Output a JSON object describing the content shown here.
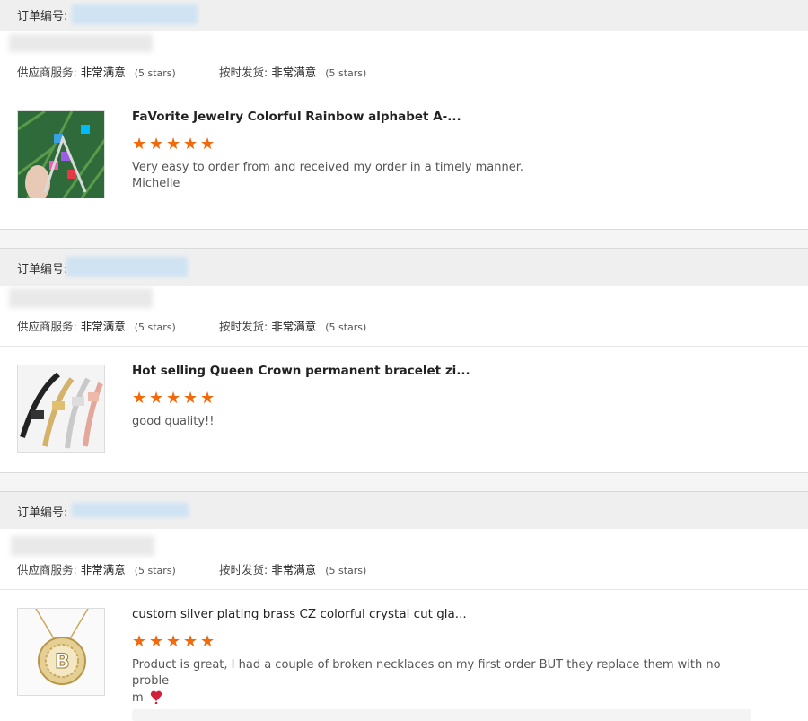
{
  "orders": [
    {
      "order_label": "订单编号:",
      "supplier_label": "供应商服务:",
      "supplier_value": "非常满意",
      "supplier_stars": "(5 stars)",
      "ship_label": "按时发货:",
      "ship_value": "非常满意",
      "ship_stars": "(5 stars)",
      "product_title": "FaVorite Jewelry Colorful Rainbow alphabet A-...",
      "rating": 5,
      "review_line1": "Very easy to order from and received my order in a timely manner.",
      "review_line2": "Michelle"
    },
    {
      "order_label": "订单编号:",
      "supplier_label": "供应商服务:",
      "supplier_value": "非常满意",
      "supplier_stars": "(5 stars)",
      "ship_label": "按时发货:",
      "ship_value": "非常满意",
      "ship_stars": "(5 stars)",
      "product_title": "Hot selling Queen Crown permanent bracelet zi...",
      "rating": 5,
      "review_line1": "good quality!!",
      "review_line2": ""
    },
    {
      "order_label": "订单编号:",
      "supplier_label": "供应商服务:",
      "supplier_value": "非常满意",
      "supplier_stars": "(5 stars)",
      "ship_label": "按时发货:",
      "ship_value": "非常满意",
      "ship_stars": "(5 stars)",
      "product_title": "custom silver plating brass CZ colorful crystal cut gla...",
      "rating": 5,
      "review_line1": "Product is great, I had a couple of broken necklaces on my first order BUT they replace them with no proble",
      "review_line2": "m"
    }
  ],
  "colors": {
    "star": "#f2690b",
    "header_bg": "#efefef",
    "redacted": "#cfe3f3"
  },
  "icons": {
    "star": "star-icon",
    "heart": "heart-emoji-icon"
  }
}
